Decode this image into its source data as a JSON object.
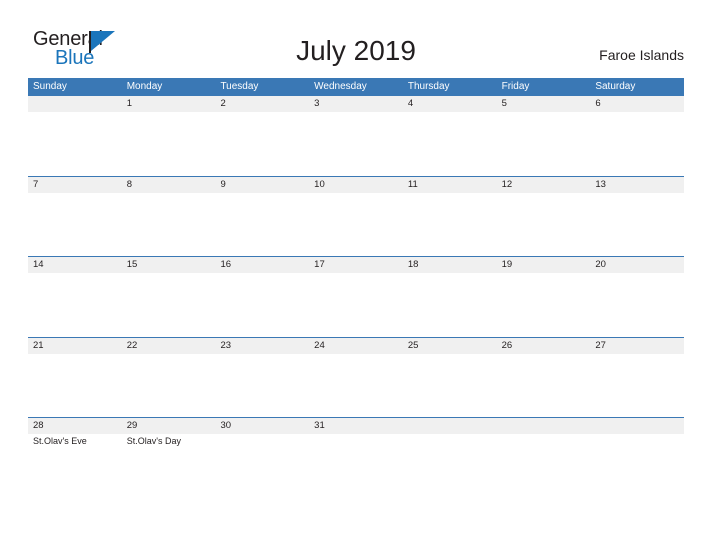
{
  "brand": {
    "name_part1": "General",
    "name_part2": "Blue",
    "flag_icon": "flag-icon",
    "accent_color": "#1b75bb"
  },
  "header": {
    "title": "July 2019",
    "location": "Faroe Islands"
  },
  "colors": {
    "header_blue": "#3a78b5",
    "date_band_gray": "#f0f0f0",
    "text": "#231f20",
    "background": "#ffffff"
  },
  "calendar": {
    "month": "July",
    "year": "2019",
    "weekday_headers": [
      "Sunday",
      "Monday",
      "Tuesday",
      "Wednesday",
      "Thursday",
      "Friday",
      "Saturday"
    ],
    "weeks": [
      {
        "dates": [
          "",
          "1",
          "2",
          "3",
          "4",
          "5",
          "6"
        ],
        "events": [
          "",
          "",
          "",
          "",
          "",
          "",
          ""
        ]
      },
      {
        "dates": [
          "7",
          "8",
          "9",
          "10",
          "11",
          "12",
          "13"
        ],
        "events": [
          "",
          "",
          "",
          "",
          "",
          "",
          ""
        ]
      },
      {
        "dates": [
          "14",
          "15",
          "16",
          "17",
          "18",
          "19",
          "20"
        ],
        "events": [
          "",
          "",
          "",
          "",
          "",
          "",
          ""
        ]
      },
      {
        "dates": [
          "21",
          "22",
          "23",
          "24",
          "25",
          "26",
          "27"
        ],
        "events": [
          "",
          "",
          "",
          "",
          "",
          "",
          ""
        ]
      },
      {
        "dates": [
          "28",
          "29",
          "30",
          "31",
          "",
          "",
          ""
        ],
        "events": [
          "St.Olav's Eve",
          "St.Olav's Day",
          "",
          "",
          "",
          "",
          ""
        ]
      }
    ]
  }
}
